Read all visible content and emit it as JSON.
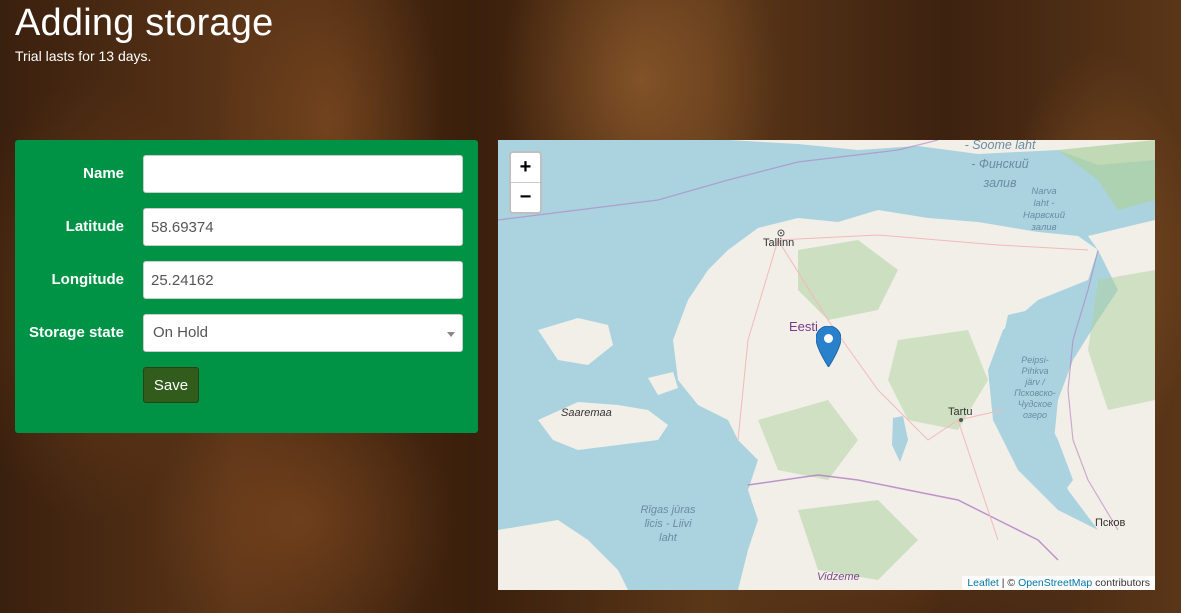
{
  "header": {
    "title": "Adding storage",
    "subtitle": "Trial lasts for 13 days."
  },
  "form": {
    "name_label": "Name",
    "name_value": "",
    "latitude_label": "Latitude",
    "latitude_value": "58.69374",
    "longitude_label": "Longitude",
    "longitude_value": "25.24162",
    "storage_state_label": "Storage state",
    "storage_state_value": "On Hold",
    "save_label": "Save"
  },
  "map": {
    "zoom_in": "+",
    "zoom_out": "−",
    "labels": {
      "gulf_finland": "- Soome laht\n- Финский\nзалив",
      "narva": "Narva\nlaht -\nНарвский\nзалив",
      "tallinn": "Tallinn",
      "eesti": "Eesti",
      "saaremaa": "Saaremaa",
      "tartu": "Tartu",
      "peipsi": "Peipsi-\nPihkva\njärv /\nПсковско-\nЧудское\nозеро",
      "riga_gulf": "Rīgas jūras\nlīcis - Liivi\nlaht",
      "pskov": "Псков",
      "vidzeme": "Vidzeme"
    },
    "attribution": {
      "leaflet": "Leaflet",
      "separator": " | © ",
      "osm": "OpenStreetMap",
      "contributors": " contributors"
    },
    "marker_icon": "map-marker-icon",
    "colors": {
      "water": "#aad3df",
      "land": "#f2efe9",
      "forest": "#add19e",
      "marker": "#2a81cb"
    }
  }
}
